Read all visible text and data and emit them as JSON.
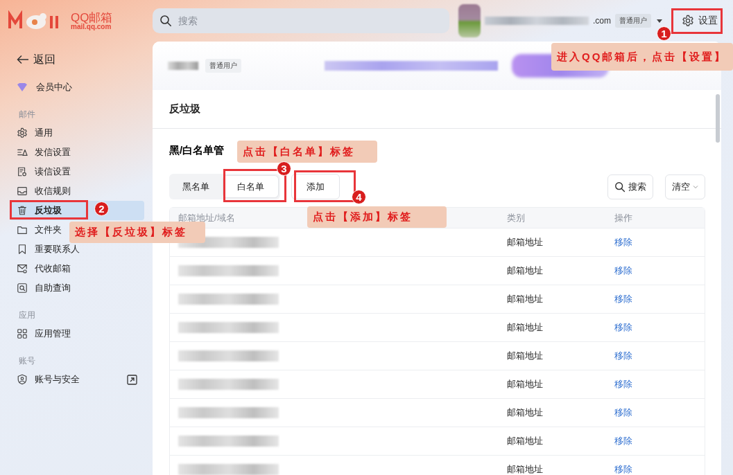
{
  "header": {
    "logo_text": "QQ邮箱",
    "logo_domain": "mail.qq.com",
    "search_placeholder": "搜索",
    "account_suffix": ".com",
    "account_badge": "普通用户",
    "settings_label": "设置"
  },
  "sidebar": {
    "back_label": "返回",
    "vip_label": "会员中心",
    "sections": [
      {
        "title": "邮件",
        "items": [
          {
            "label": "通用",
            "kind": "gear",
            "selected": false,
            "external": false
          },
          {
            "label": "发信设置",
            "kind": "send",
            "selected": false,
            "external": false
          },
          {
            "label": "读信设置",
            "kind": "read",
            "selected": false,
            "external": false
          },
          {
            "label": "收信规则",
            "kind": "inbox",
            "selected": false,
            "external": false
          },
          {
            "label": "反垃圾",
            "kind": "trash",
            "selected": true,
            "external": false
          },
          {
            "label": "文件夹",
            "kind": "folder",
            "selected": false,
            "external": false
          },
          {
            "label": "重要联系人",
            "kind": "bookmark",
            "selected": false,
            "external": false
          },
          {
            "label": "代收邮箱",
            "kind": "mail",
            "selected": false,
            "external": false
          },
          {
            "label": "自助查询",
            "kind": "query",
            "selected": false,
            "external": false
          }
        ]
      },
      {
        "title": "应用",
        "items": [
          {
            "label": "应用管理",
            "kind": "grid",
            "selected": false,
            "external": false
          }
        ]
      },
      {
        "title": "账号",
        "items": [
          {
            "label": "账号与安全",
            "kind": "shield",
            "selected": false,
            "external": true
          }
        ]
      }
    ]
  },
  "profile": {
    "badge": "普通用户"
  },
  "page_title": "反垃圾",
  "section_title": "黑/白名单管",
  "tabs": [
    {
      "label": "黑名单",
      "selected": false
    },
    {
      "label": "白名单",
      "selected": true
    }
  ],
  "add_button": "添加",
  "search_button": "搜索",
  "clear_button": "清空",
  "table": {
    "columns": [
      "邮箱地址/域名",
      "类别",
      "操作"
    ],
    "rows": [
      {
        "type": "邮箱地址",
        "action": "移除"
      },
      {
        "type": "邮箱地址",
        "action": "移除"
      },
      {
        "type": "邮箱地址",
        "action": "移除"
      },
      {
        "type": "邮箱地址",
        "action": "移除"
      },
      {
        "type": "邮箱地址",
        "action": "移除"
      },
      {
        "type": "邮箱地址",
        "action": "移除"
      },
      {
        "type": "邮箱地址",
        "action": "移除"
      },
      {
        "type": "邮箱地址",
        "action": "移除"
      },
      {
        "type": "邮箱地址",
        "action": "移除"
      }
    ]
  },
  "annotations": [
    {
      "number": "1",
      "text": "进入QQ邮箱后，点击【设置】"
    },
    {
      "number": "2",
      "text": "选择【反垃圾】标签"
    },
    {
      "number": "3",
      "text": "点击【白名单】标签"
    },
    {
      "number": "4",
      "text": "点击【添加】标签"
    }
  ]
}
